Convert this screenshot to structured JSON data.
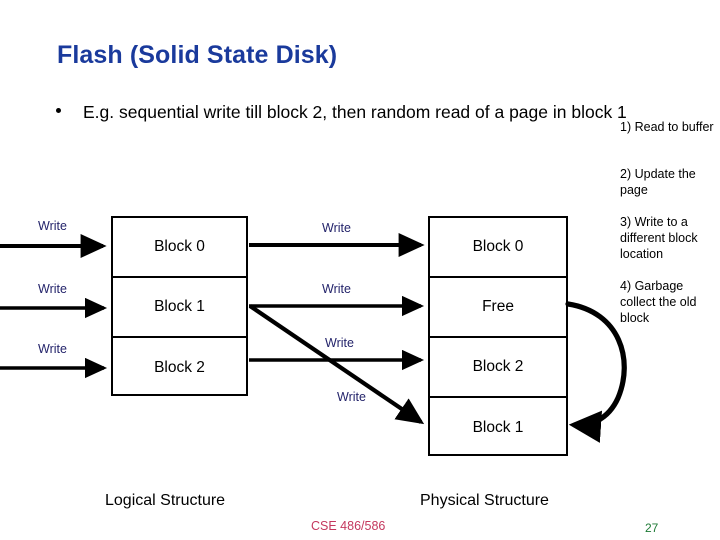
{
  "slide": {
    "title": "Flash (Solid State Disk)",
    "bullet": "E.g. sequential write till block 2, then random read of a page in block 1",
    "course_tag": "CSE 486/586",
    "page_number": "27",
    "colors": {
      "title": "#1a3a9c",
      "write_label": "#24246b",
      "course_tag": "#c4385e",
      "page_number": "#1e7a36",
      "outline": "#000000",
      "background": "#ffffff"
    }
  },
  "notes": [
    {
      "id": "note-1",
      "text": "1) Read to buffer"
    },
    {
      "id": "note-2",
      "text": "2) Update the page"
    },
    {
      "id": "note-3",
      "text": "3) Write to a different block location"
    },
    {
      "id": "note-4",
      "text": "4) Garbage collect the old block"
    }
  ],
  "logical_structure": {
    "caption": "Logical Structure",
    "cells": [
      {
        "label": "Block 0"
      },
      {
        "label": "Block 1"
      },
      {
        "label": "Block 2"
      }
    ]
  },
  "physical_structure": {
    "caption": "Physical Structure",
    "cells": [
      {
        "label": "Block 0"
      },
      {
        "label": "Free"
      },
      {
        "label": "Block 2"
      },
      {
        "label": "Block 1"
      }
    ]
  },
  "write_labels": {
    "left": [
      {
        "text": "Write"
      },
      {
        "text": "Write"
      },
      {
        "text": "Write"
      }
    ],
    "middle": [
      {
        "text": "Write"
      },
      {
        "text": "Write"
      },
      {
        "text": "Write"
      },
      {
        "text": "Write"
      }
    ]
  },
  "icons": {
    "bullet": "bullet-dot",
    "arrow_head": "arrow-head",
    "gc_arrow": "curved-recycle-arrow"
  }
}
